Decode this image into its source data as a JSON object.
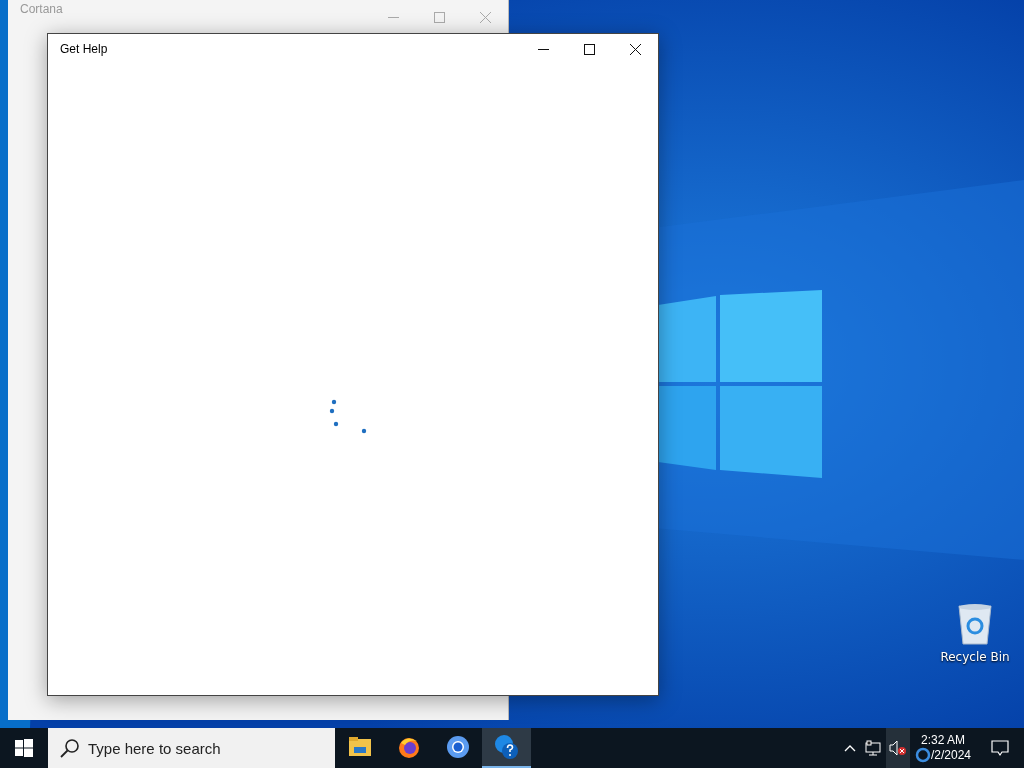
{
  "desktop": {
    "icons": [
      {
        "label": "Recycle Bin"
      }
    ]
  },
  "windows": [
    {
      "title": "Cortana",
      "active": false
    },
    {
      "title": "Get Help",
      "active": true,
      "loading": true
    }
  ],
  "taskbar": {
    "search": {
      "placeholder": "Type here to search"
    },
    "apps": [
      {
        "kind": "explorer",
        "selected": false
      },
      {
        "kind": "firefox",
        "selected": false
      },
      {
        "kind": "browser",
        "selected": false
      },
      {
        "kind": "help",
        "selected": true
      }
    ],
    "tray": {
      "volume_muted": true,
      "time": "2:32 AM",
      "date": "/2/2024"
    }
  }
}
